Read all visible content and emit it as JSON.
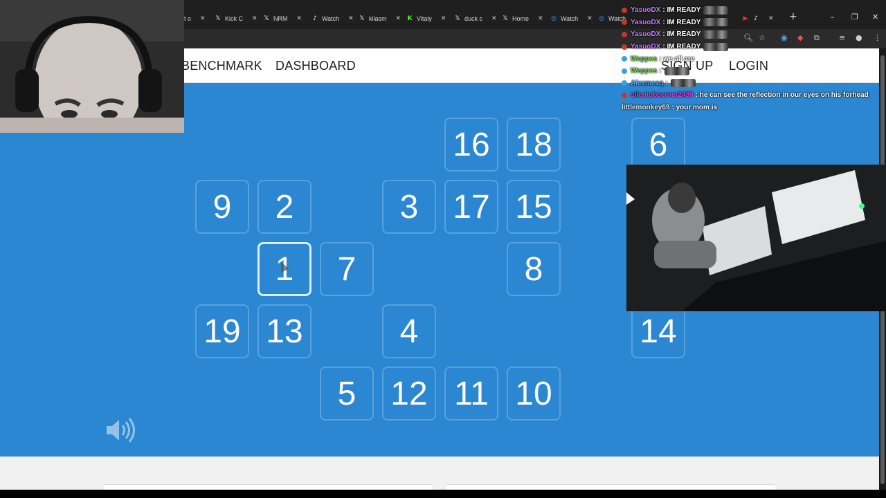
{
  "browser": {
    "tabs": [
      {
        "icon": "x-logo-icon",
        "label": "Kick C",
        "glyph": "𝕏"
      },
      {
        "icon": "x-logo-icon",
        "label": "NRM",
        "glyph": "𝕏"
      },
      {
        "icon": "tiktok-icon",
        "label": "Watch",
        "glyph": "♪"
      },
      {
        "icon": "x-logo-icon",
        "label": "kilasm",
        "glyph": "𝕏"
      },
      {
        "icon": "kick-icon",
        "label": "Vitaly",
        "glyph": "K"
      },
      {
        "icon": "x-logo-icon",
        "label": "duck c",
        "glyph": "𝕏"
      },
      {
        "icon": "x-logo-icon",
        "label": "Home",
        "glyph": "𝕏"
      },
      {
        "icon": "globe-icon",
        "label": "Watch",
        "glyph": "◎"
      },
      {
        "icon": "globe-icon",
        "label": "Watch",
        "glyph": "◎"
      }
    ],
    "partial_tab_label": "t o",
    "new_tab_glyph": "+",
    "minimize_glyph": "–",
    "maximize_glyph": "❐",
    "close_glyph": "✕"
  },
  "site": {
    "nav_left": [
      "BENCHMARK",
      "DASHBOARD"
    ],
    "nav_right": [
      "SIGN UP",
      "LOGIN"
    ]
  },
  "game": {
    "cells": [
      {
        "label": "16",
        "active": false
      },
      {
        "label": "18",
        "active": false
      },
      {
        "label": "6",
        "active": false
      },
      {
        "label": "9",
        "active": false
      },
      {
        "label": "2",
        "active": false
      },
      {
        "label": "3",
        "active": false
      },
      {
        "label": "17",
        "active": false
      },
      {
        "label": "15",
        "active": false
      },
      {
        "label": "1",
        "active": true
      },
      {
        "label": "7",
        "active": false
      },
      {
        "label": "8",
        "active": false
      },
      {
        "label": "19",
        "active": false
      },
      {
        "label": "13",
        "active": false
      },
      {
        "label": "4",
        "active": false
      },
      {
        "label": "14",
        "active": false
      },
      {
        "label": "5",
        "active": false
      },
      {
        "label": "12",
        "active": false
      },
      {
        "label": "11",
        "active": false
      },
      {
        "label": "10",
        "active": false
      }
    ],
    "sound_icon": "speaker-icon"
  },
  "chat": {
    "messages": [
      {
        "user": "YasuoDX",
        "text": ": IM READY",
        "color": "#c77dff",
        "badge": "#c0392b",
        "emote": true
      },
      {
        "user": "YasuoDX",
        "text": ": IM READY",
        "color": "#c77dff",
        "badge": "#c0392b",
        "emote": true
      },
      {
        "user": "YasuoDX",
        "text": ": IM READY",
        "color": "#c77dff",
        "badge": "#c0392b",
        "emote": true
      },
      {
        "user": "YasuoDX",
        "text": ": IM READY",
        "color": "#c77dff",
        "badge": "#c0392b",
        "emote": true
      },
      {
        "user": "Weppes",
        "text": ": we all are",
        "color": "#7bd95c",
        "badge": "#3aa0e0",
        "emote": false
      },
      {
        "user": "Weppes",
        "text": ":",
        "color": "#7bd95c",
        "badge": "#3aa0e0",
        "emote": true
      },
      {
        "user": "Alexmesq",
        "text": ":",
        "color": "#5aa6e8",
        "badge": "#3aa0e0",
        "emote": true
      },
      {
        "user": "silentobserver2439",
        "text": ": he can see the reflection in our eyes on his forhead",
        "color": "#d946d9",
        "badge": "#c0392b",
        "emote": false
      },
      {
        "user": "littlemonkey69",
        "text": ": your mom is",
        "color": "#e8e8e8",
        "badge": "",
        "emote": false
      }
    ]
  }
}
